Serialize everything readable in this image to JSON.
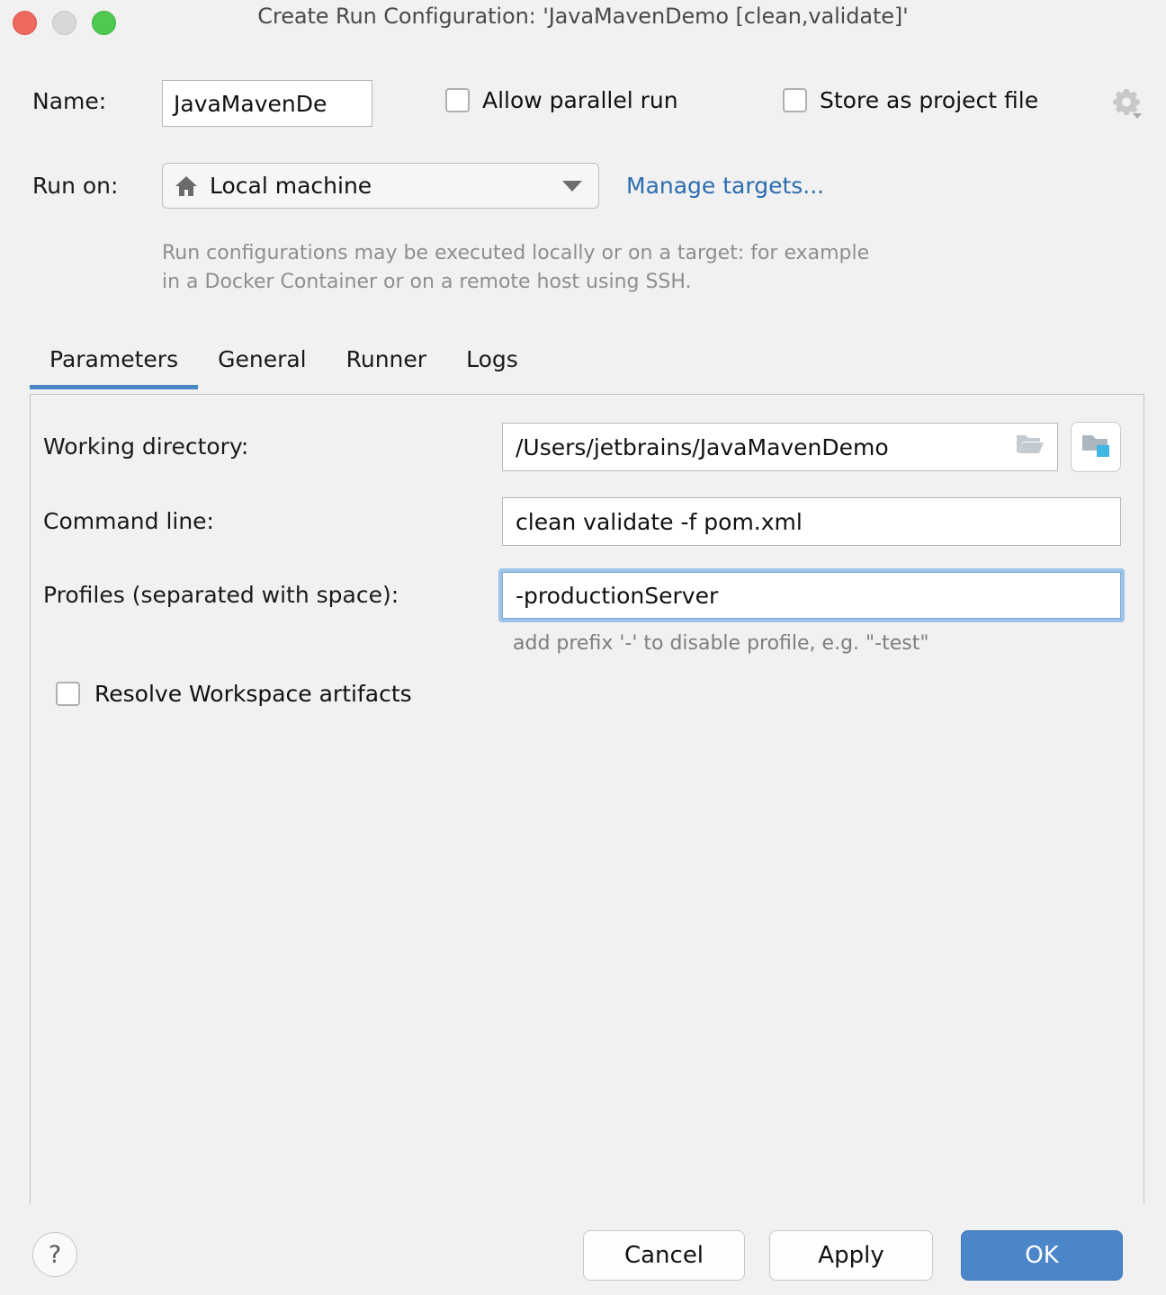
{
  "window": {
    "title": "Create Run Configuration: 'JavaMavenDemo [clean,validate]'",
    "traffic_lights": [
      "close-button",
      "minimize-button",
      "maximize-button"
    ]
  },
  "form": {
    "name_label": "Name:",
    "name_value": "JavaMavenDe",
    "allow_parallel_label": "Allow parallel run",
    "allow_parallel_checked": false,
    "store_as_project_label": "Store as project file",
    "store_as_project_checked": false,
    "gear_icon": "gear-icon",
    "run_on_label": "Run on:",
    "run_on_value": "Local machine",
    "run_on_icon": "home-icon",
    "manage_targets_label": "Manage targets...",
    "hint_line1": "Run configurations may be executed locally or on a target: for example",
    "hint_line2": "in a Docker Container or on a remote host using SSH."
  },
  "tabs": [
    {
      "label": "Parameters",
      "active": true
    },
    {
      "label": "General",
      "active": false
    },
    {
      "label": "Runner",
      "active": false
    },
    {
      "label": "Logs",
      "active": false
    }
  ],
  "parameters": {
    "working_directory_label": "Working directory:",
    "working_directory_value": "/Users/jetbrains/JavaMavenDemo",
    "working_directory_browse_icon": "folder-open-icon",
    "working_directory_macro_icon": "folder-module-icon",
    "command_line_label": "Command line:",
    "command_line_value": "clean validate -f pom.xml",
    "profiles_label": "Profiles (separated with space):",
    "profiles_value": "-productionServer",
    "profiles_hint": "add prefix '-' to disable profile, e.g. \"-test\"",
    "resolve_workspace_label": "Resolve Workspace artifacts",
    "resolve_workspace_checked": false
  },
  "footer": {
    "help_label": "?",
    "cancel_label": "Cancel",
    "apply_label": "Apply",
    "ok_label": "OK"
  },
  "colors": {
    "accent": "#4a87c8",
    "link": "#2c6cb0",
    "primary_button": "#4b86c8",
    "focus_ring": "#9cc4ea",
    "background": "#f1f1f1"
  }
}
